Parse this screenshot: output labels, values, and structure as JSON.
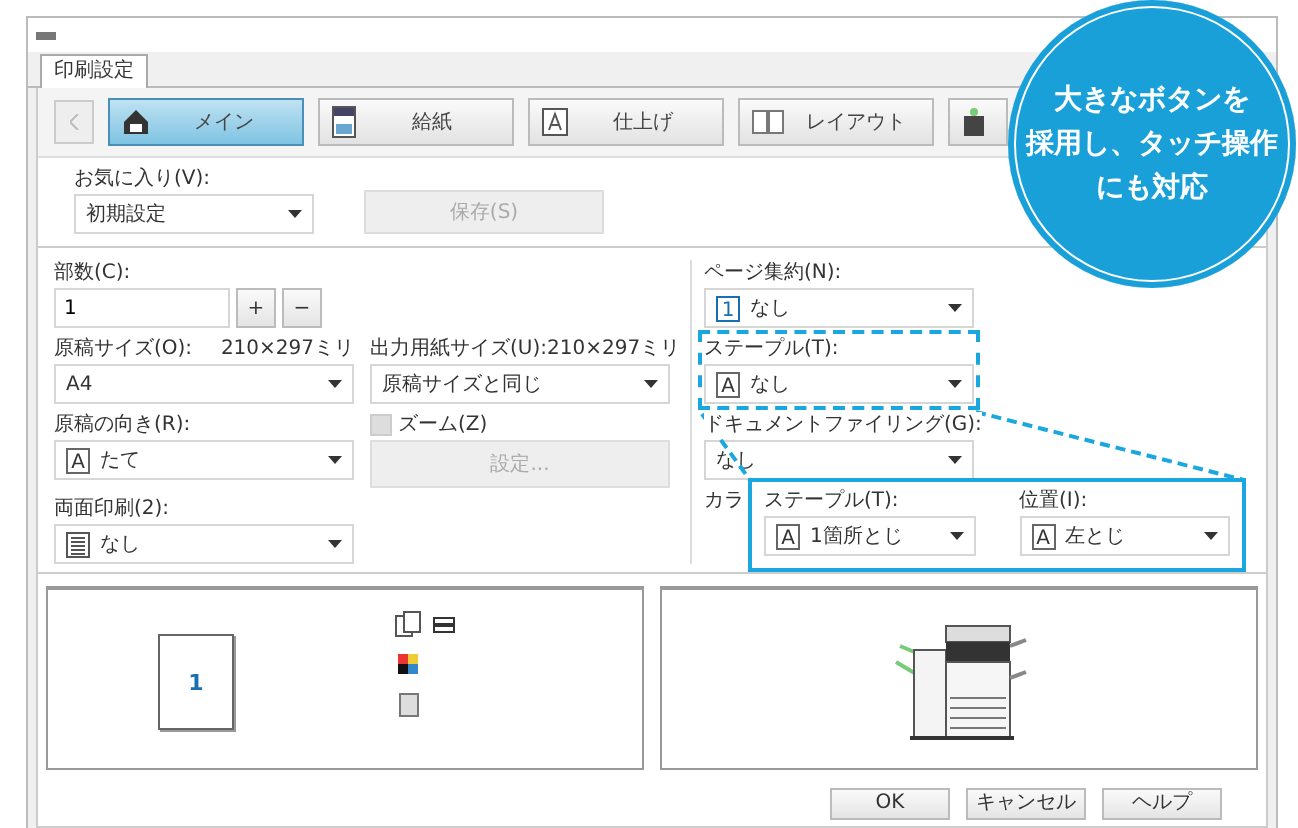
{
  "window": {
    "tab": "印刷設定"
  },
  "nav_buttons": [
    {
      "label": "メイン",
      "selected": true
    },
    {
      "label": "給紙",
      "selected": false
    },
    {
      "label": "仕上げ",
      "selected": false
    },
    {
      "label": "レイアウト",
      "selected": false
    },
    {
      "selected": false
    }
  ],
  "favorites": {
    "label": "お気に入り(V):",
    "value": "初期設定"
  },
  "save_button": {
    "label": "保存(S)",
    "disabled": true
  },
  "rows": [
    {
      "left": {
        "kind": "spinner",
        "label": "部数(C):",
        "value": "1",
        "buttons": [
          "+",
          "−"
        ]
      }
    },
    {
      "left": {
        "kind": "dropdown",
        "label": "原稿サイズ(O):",
        "note": "210×297ミリ",
        "value": "A4"
      },
      "middle": {
        "kind": "dropdown",
        "label": "出力用紙サイズ(U):",
        "note": "210×297ミリ",
        "value": "原稿サイズと同じ"
      }
    },
    {
      "left": {
        "kind": "letter-dropdown",
        "label": "原稿の向き(R):",
        "value": "たて",
        "icon_text": "A"
      },
      "middle": {
        "kind": "checkbox",
        "label": "ズーム(Z)",
        "checked": false,
        "disabled": true,
        "button": "設定..."
      }
    },
    {
      "left": {
        "kind": "lines-dropdown",
        "label": "両面印刷(2):",
        "value": "なし"
      }
    }
  ],
  "right_column": [
    {
      "kind": "number-dropdown",
      "label": "ページ集約(N):",
      "value": "なし",
      "icon_text": "1",
      "highlighted": false
    },
    {
      "kind": "letter-dropdown",
      "label": "ステープル(T):",
      "value": "なし",
      "icon_text": "A",
      "highlighted": true
    },
    {
      "kind": "dropdown",
      "label": "ドキュメントファイリング(G):",
      "value": "なし",
      "highlighted": false
    },
    {
      "kind": "label",
      "label": "カラ"
    }
  ],
  "preview": {
    "page_number": "1"
  },
  "buttons": [
    "OK",
    "キャンセル",
    "ヘルプ"
  ],
  "callout": {
    "fields": [
      {
        "label": "ステープル(T):",
        "value": "1箇所とじ",
        "icon_text": "A"
      },
      {
        "label": "位置(I):",
        "value": "左とじ",
        "icon_text": "A"
      }
    ]
  },
  "badge": {
    "lines": [
      "大きなボタンを",
      "採用し、タッチ操作",
      "にも対応"
    ]
  }
}
